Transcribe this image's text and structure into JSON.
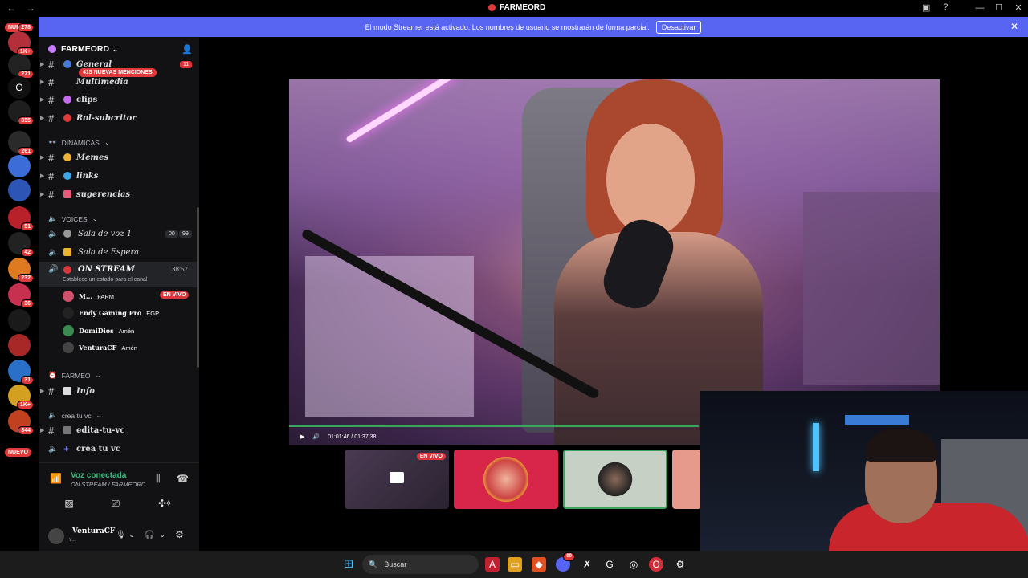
{
  "window": {
    "title": "FARMEORD"
  },
  "banner": {
    "message": "El modo Streamer está activado. Los nombres de usuario se mostrarán de forma parcial.",
    "button": "Desactivar"
  },
  "guilds": {
    "badges": [
      "278",
      "1K+",
      "271",
      "855",
      "261",
      "51",
      "42",
      "232",
      "36",
      "31",
      "1K+",
      "344"
    ],
    "new_label": "NUEVO",
    "o_label": "O"
  },
  "server": {
    "name": "FARMEORD",
    "mentions_pill": "415 NUEVAS MENCIONES",
    "general_badge": "11",
    "channels_top": [
      {
        "name": "General"
      },
      {
        "name": "Multimedia"
      },
      {
        "name": "clips"
      },
      {
        "name": "Rol-subcritor"
      }
    ],
    "cat_dinamicas": "DINAMICAS",
    "channels_dinamicas": [
      {
        "name": "Memes"
      },
      {
        "name": "links"
      },
      {
        "name": "sugerencias"
      }
    ],
    "cat_voices": "VOICES",
    "voice_channels": [
      {
        "name": "Sala de voz 1",
        "pill_a": "00",
        "pill_b": "99"
      },
      {
        "name": "Sala de Espera"
      },
      {
        "name": "ON STREAM",
        "time": "38:57",
        "status": "Establece un estado para el canal"
      }
    ],
    "voice_users": [
      {
        "name": "M...",
        "tag": "FARM",
        "live": "EN VIVO"
      },
      {
        "name": "Endy Gaming Pro",
        "tag": "EGP"
      },
      {
        "name": "DomiDios",
        "tag": "Amén"
      },
      {
        "name": "VenturaCF",
        "tag": "Amén"
      }
    ],
    "cat_farmeo": "FARMEO",
    "channels_farmeo": [
      {
        "name": "Info"
      }
    ],
    "cat_crea": "crea tu vc",
    "channels_crea": [
      {
        "name": "edita-tu-vc"
      },
      {
        "name": "crea tu vc"
      }
    ]
  },
  "voice_connection": {
    "title": "Voz conectada",
    "channel": "ON STREAM / FARMEORD"
  },
  "user_panel": {
    "name": "VenturaCF",
    "status": "v..."
  },
  "player": {
    "time": "01:01:46 / 01:37:38",
    "progress": 0.63
  },
  "thumbnails": {
    "live_label": "EN VIVO"
  },
  "taskbar": {
    "search_placeholder": "Buscar",
    "discord_badge": "99"
  },
  "colors": {
    "accent": "#5865f2",
    "live": "#da373c",
    "voice_green": "#3ba55d"
  }
}
